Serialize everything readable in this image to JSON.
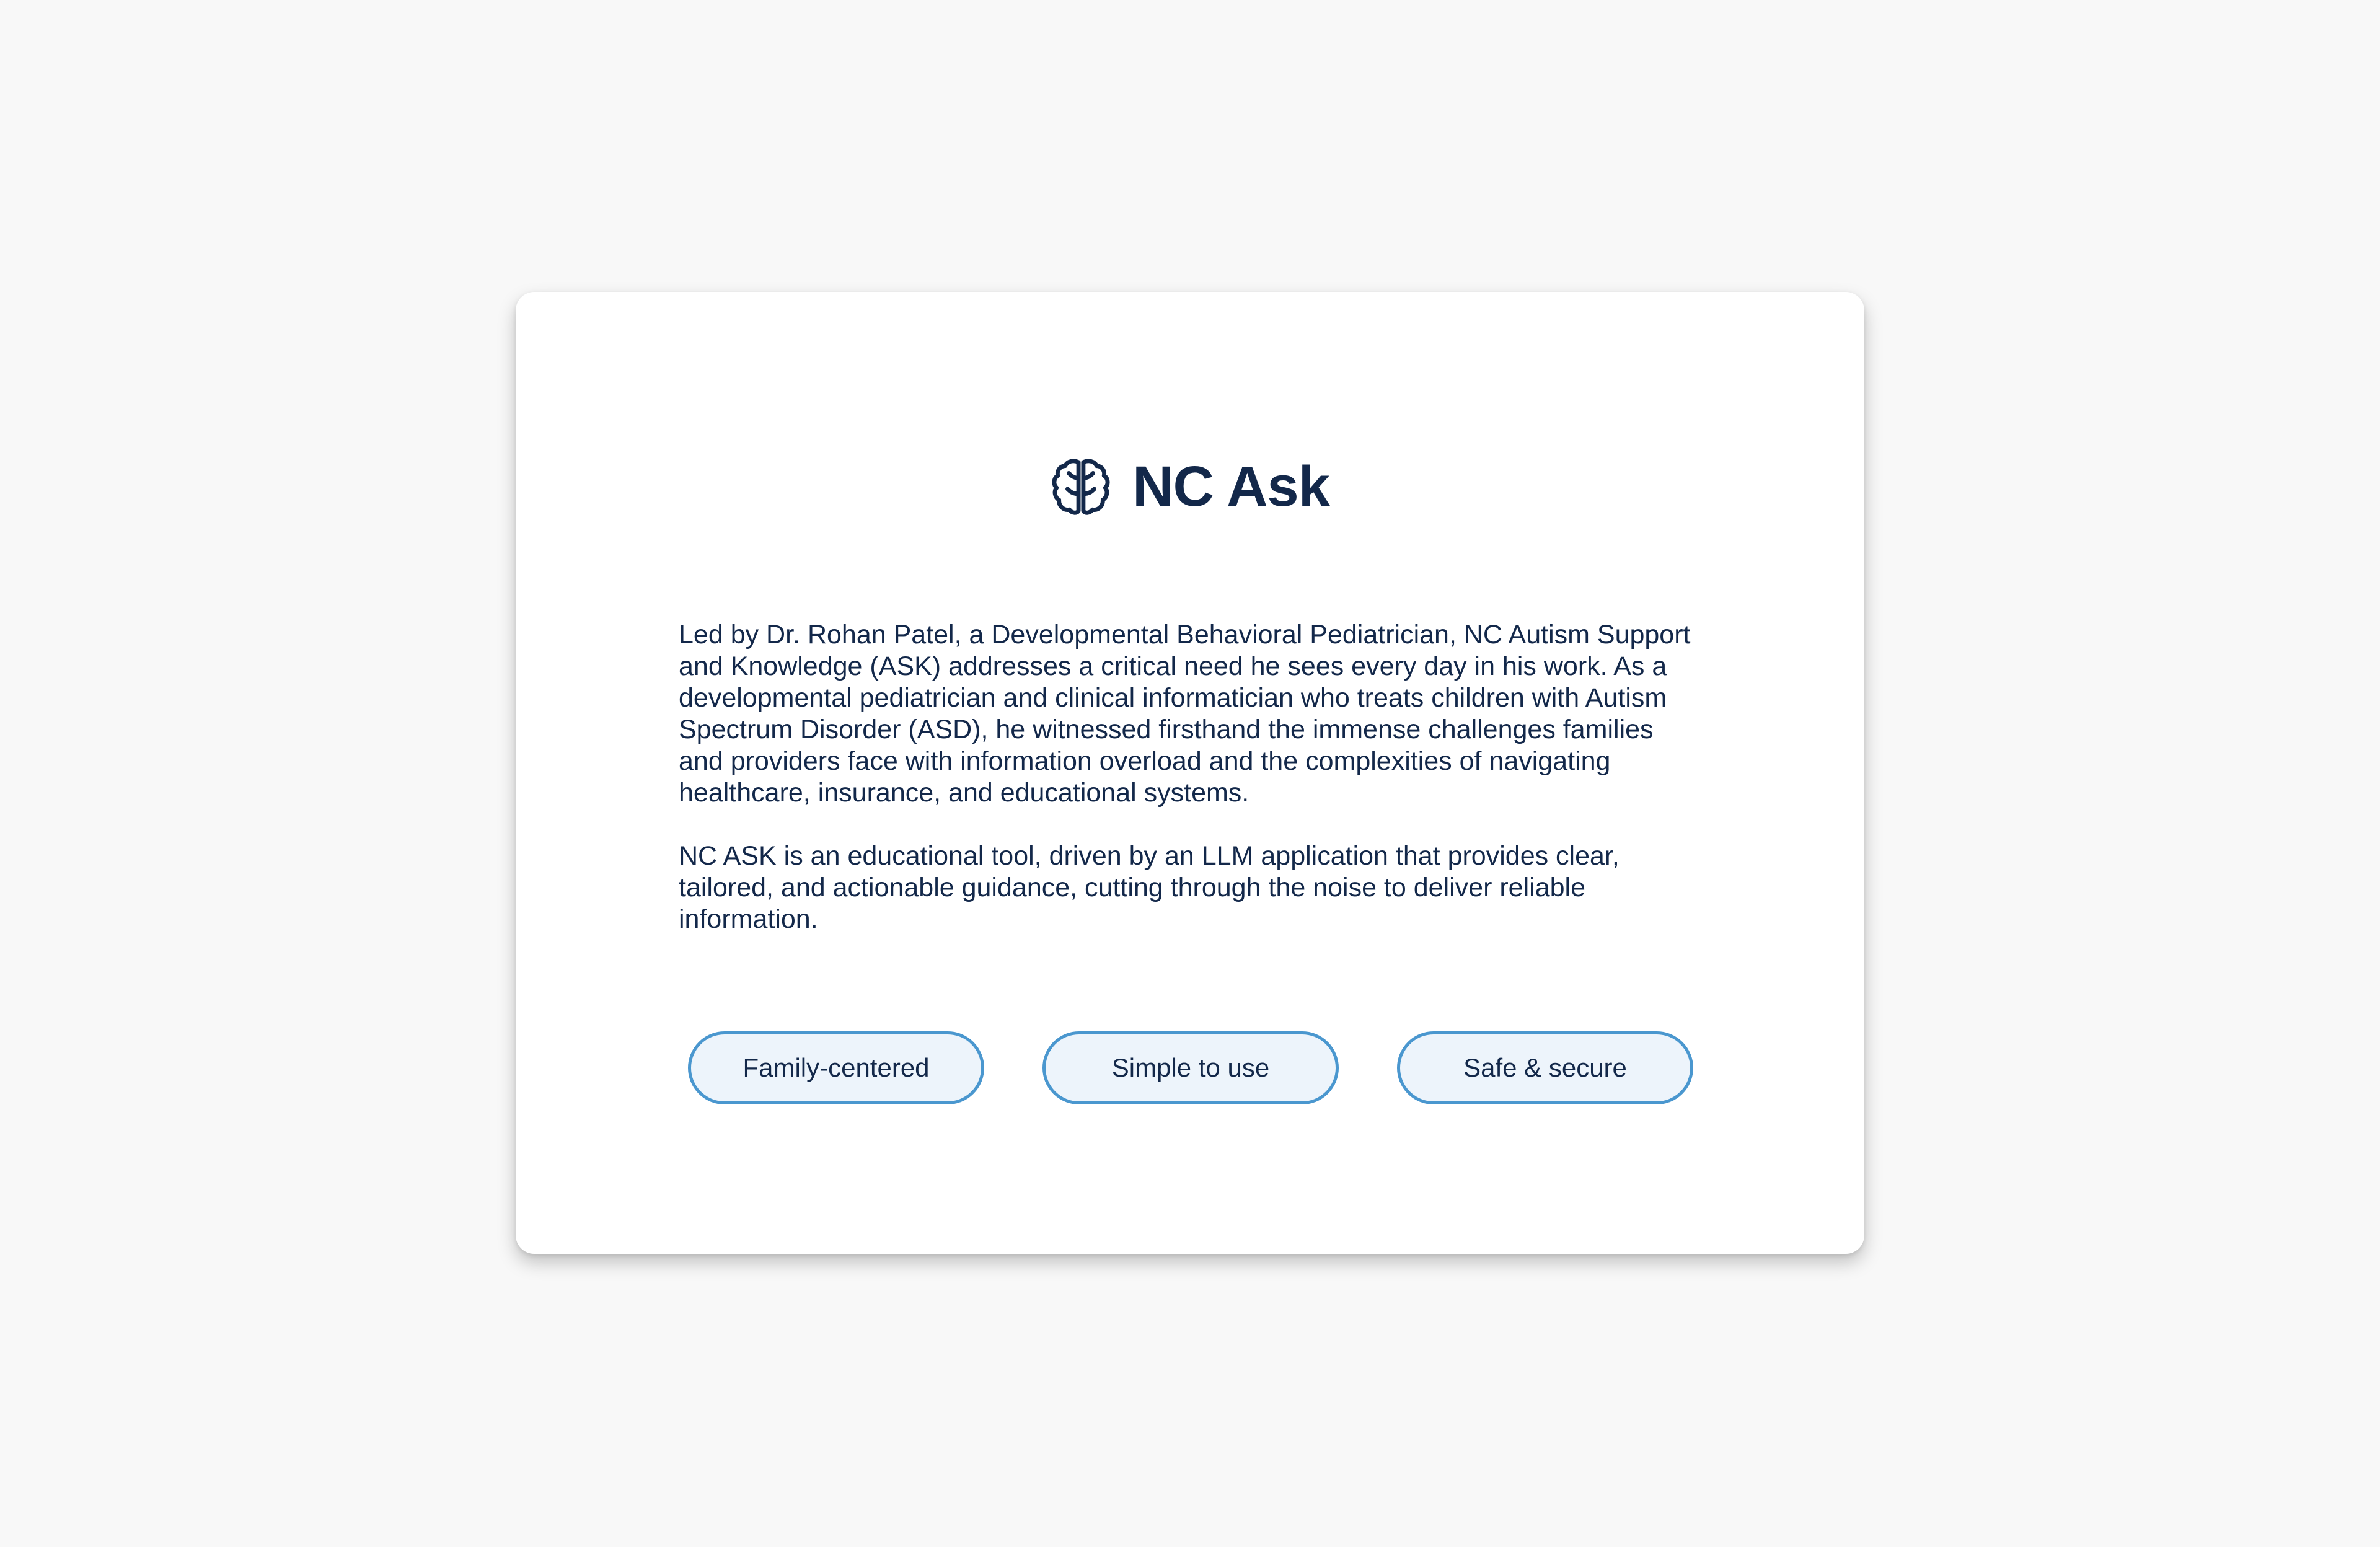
{
  "brand": {
    "icon": "brain-icon",
    "title": "NC Ask"
  },
  "about": {
    "paragraphs": [
      "Led by Dr. Rohan Patel, a Developmental Behavioral Pediatrician, NC Autism Support and Knowledge (ASK) addresses a critical need he sees every day in his work. As a developmental pediatrician and clinical informatician who treats children with Autism Spectrum Disorder (ASD), he witnessed firsthand the immense challenges families and providers face with information overload and the complexities of navigating healthcare, insurance, and educational systems.",
      "NC ASK is an educational tool, driven by an LLM application that provides clear, tailored, and actionable guidance, cutting through the noise to deliver reliable information."
    ]
  },
  "features": [
    {
      "label": "Family-centered"
    },
    {
      "label": "Simple to use"
    },
    {
      "label": "Safe & secure"
    }
  ],
  "colors": {
    "background": "#f8f8f8",
    "card": "#ffffff",
    "text": "#13284a",
    "pill_border": "#4a97cf",
    "pill_fill": "#edf4fb"
  }
}
